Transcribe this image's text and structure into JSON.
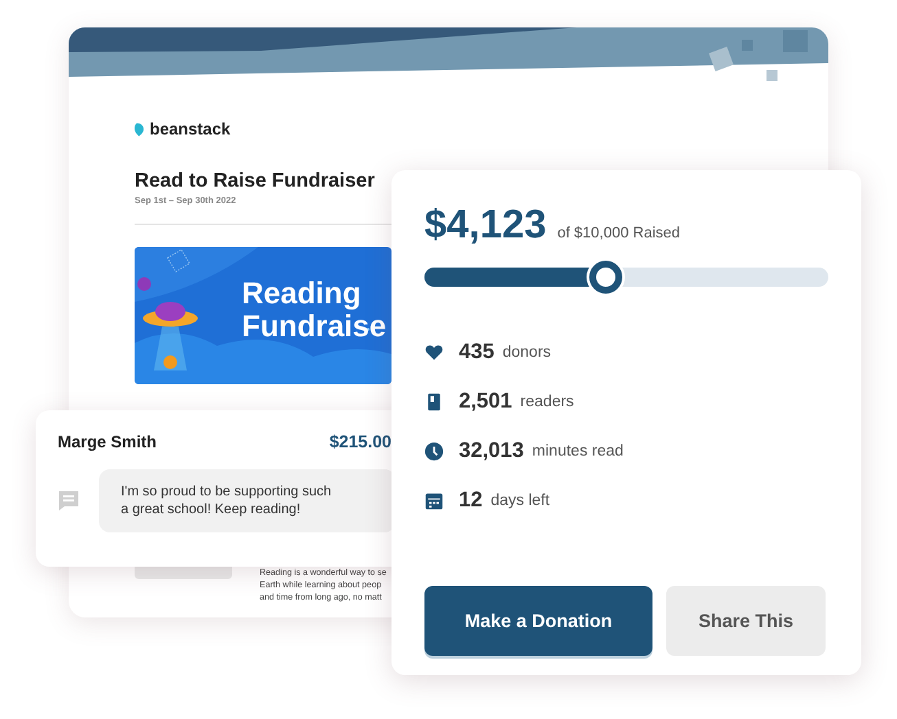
{
  "page": {
    "logo": "beanstack",
    "title": "Read to Raise Fundraiser",
    "dates": "Sep 1st – Sep 30th 2022",
    "banner": {
      "kind": "picture",
      "title_lines": [
        "Reading",
        "Fundraise"
      ]
    },
    "description_lines": [
      "Reading is a wonderful way to se",
      "Earth while learning about peop",
      "and time from long ago, no matt"
    ]
  },
  "comment": {
    "name": "Marge Smith",
    "amount": "$215.00",
    "message": "I'm so proud to be supporting such a great school! Keep reading!"
  },
  "fundraiser": {
    "raised": "$4,123",
    "goal": "of $10,000 Raised",
    "progress": {
      "level": 0.45
    },
    "stats": [
      {
        "kind": "heart",
        "value": "435",
        "label": "donors"
      },
      {
        "kind": "book",
        "value": "2,501",
        "label": "readers"
      },
      {
        "kind": "clock",
        "value": "32,013",
        "label": "minutes read"
      },
      {
        "kind": "calendar",
        "value": "12",
        "label": "days left"
      }
    ],
    "buttons": [
      {
        "label": "Make a Donation",
        "kind": "primary"
      },
      {
        "label": "Share This",
        "kind": "secondary"
      }
    ]
  }
}
